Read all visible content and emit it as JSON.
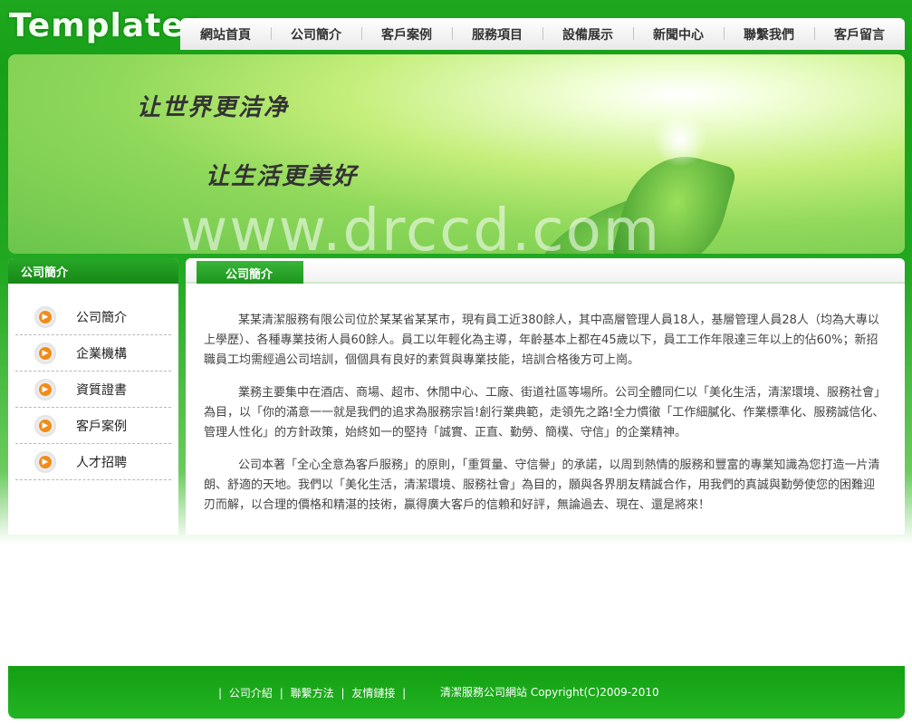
{
  "logo": "Templates",
  "nav": [
    "網站首頁",
    "公司簡介",
    "客戶案例",
    "服務項目",
    "設備展示",
    "新聞中心",
    "聯繫我們",
    "客戶留言"
  ],
  "banner": {
    "slogan1": "让世界更洁净",
    "slogan2": "让生活更美好",
    "watermark": "www.drccd.com"
  },
  "sidebar": {
    "title": "公司簡介",
    "items": [
      "公司簡介",
      "企業機構",
      "資質證書",
      "客戶案例",
      "人才招聘"
    ]
  },
  "main": {
    "title": "公司簡介",
    "paragraphs": [
      "某某清潔服務有限公司位於某某省某某市，現有員工近380餘人，其中高層管理人員18人，基層管理人員28人（均為大專以上學歷）、各種專業技術人員60餘人。員工以年輕化為主導，年齡基本上都在45歲以下，員工工作年限達三年以上的佔60%；新招職員工均需經過公司培訓，個個具有良好的素質與專業技能，培訓合格後方可上崗。",
      "業務主要集中在酒店、商場、超市、休閒中心、工廠、街道社區等場所。公司全體同仁以「美化生活，清潔環境、服務社會」為目，以「你的滿意一一就是我們的追求為服務宗旨!創行業典範，走領先之路!全力慣徹「工作細膩化、作業標準化、服務誠信化、管理人性化」的方針政策，始終如一的堅持「誠實、正直、勤勞、簡樸、守信」的企業精神。",
      "公司本著「全心全意為客戶服務」的原則，「重質量、守信譽」的承諾，以周到熱情的服務和豐富的專業知識為您打造一片清朗、舒適的天地。我們以「美化生活，清潔環境、服務社會」為目的，願與各界朋友精誠合作，用我們的真誠與勤勞使您的困難迎刃而解，以合理的價格和精湛的技術，贏得廣大客戶的信賴和好評，無論過去、現在、還是將來！"
    ]
  },
  "footer": {
    "separator": "|",
    "links": [
      "公司介紹",
      "聯繫方法",
      "友情鏈接"
    ],
    "copyright": "清潔服務公司網站 Copyright(C)2009-2010"
  },
  "colors": {
    "primary_green": "#1a9e1a",
    "accent_orange": "#f08c1a"
  },
  "icons": {
    "side_item_icon": "orange-arrow-bullet-icon"
  }
}
